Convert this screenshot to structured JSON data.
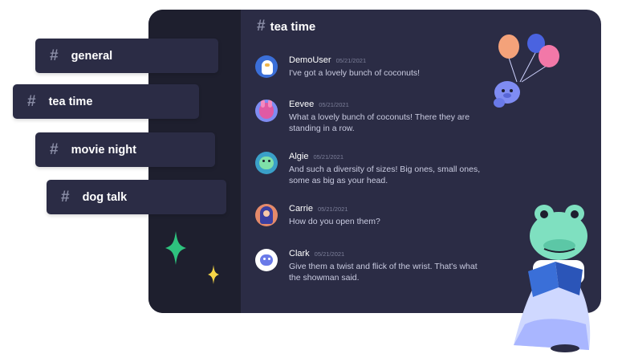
{
  "channel_header": {
    "name": "tea time"
  },
  "channel_pills": [
    {
      "name": "general"
    },
    {
      "name": "tea time"
    },
    {
      "name": "movie night"
    },
    {
      "name": "dog talk"
    }
  ],
  "messages": [
    {
      "author": "DemoUser",
      "timestamp": "05/21/2021",
      "text": "I've got a lovely bunch of coconuts!",
      "avatar_color": "#3b6fd8"
    },
    {
      "author": "Eevee",
      "timestamp": "05/21/2021",
      "text": "What a lovely bunch of coconuts! There they are standing in a row.",
      "avatar_color": "#e05aa3"
    },
    {
      "author": "Algie",
      "timestamp": "05/21/2021",
      "text": "And such a diversity of sizes! Big ones, small ones, some as big as your head.",
      "avatar_color": "#3aa0c8"
    },
    {
      "author": "Carrie",
      "timestamp": "05/21/2021",
      "text": "How do you open them?",
      "avatar_color": "#e58a6a"
    },
    {
      "author": "Clark",
      "timestamp": "05/21/2021",
      "text": "Give them a twist and flick of the wrist. That's what the showman said.",
      "avatar_color": "#ffffff"
    }
  ],
  "colors": {
    "window_bg": "#2b2c45",
    "sidebar_bg": "#1e1f2e",
    "sparkle_green": "#2ec27e",
    "sparkle_yellow": "#f5d547",
    "balloon_orange": "#f4a27a",
    "balloon_blue": "#4a63e0",
    "balloon_pink": "#f278a8"
  },
  "icons": {
    "hash": "#",
    "illustrations": [
      "balloon-creature-illustration",
      "frog-reading-illustration"
    ]
  }
}
